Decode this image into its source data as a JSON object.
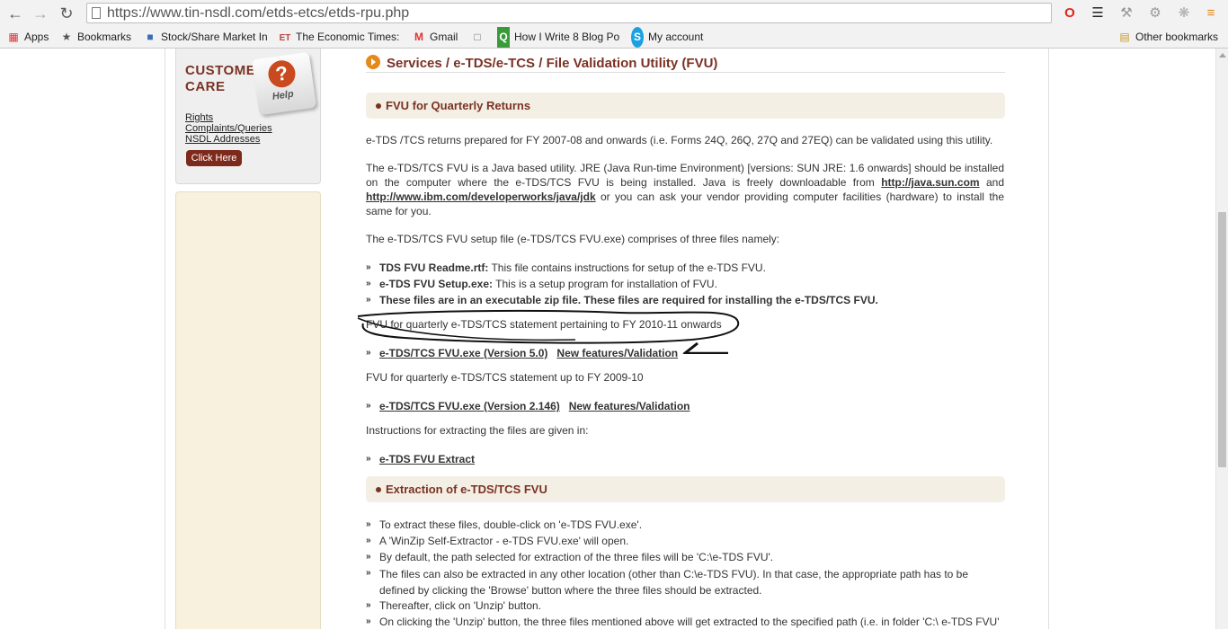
{
  "browser": {
    "url": "https://www.tin-nsdl.com/etds-etcs/etds-rpu.php",
    "bookmarks": [
      {
        "label": "Apps",
        "icon": "apps-grid-icon"
      },
      {
        "label": "Bookmarks",
        "icon": "star-icon"
      },
      {
        "label": "Stock/Share Market In",
        "icon": "site-favicon"
      },
      {
        "label": "The Economic Times:",
        "icon": "et-favicon"
      },
      {
        "label": "Gmail",
        "icon": "gmail-icon"
      },
      {
        "label": "",
        "icon": "page-icon"
      },
      {
        "label": "How I Write 8 Blog Po",
        "icon": "q-favicon"
      },
      {
        "label": "My account",
        "icon": "skype-icon"
      }
    ],
    "other_bookmarks": "Other bookmarks"
  },
  "sidebar": {
    "customer_care_line1": "CUSTOMER",
    "customer_care_line2": "CARE",
    "help_label": "Help",
    "links": [
      "Rights",
      "Complaints/Queries",
      "NSDL Addresses"
    ],
    "click_here": "Click Here"
  },
  "main": {
    "breadcrumb": "Services / e-TDS/e-TCS / File Validation Utility (FVU)",
    "section1": "FVU for Quarterly Returns",
    "para1": "e-TDS /TCS returns prepared for FY 2007-08 and onwards (i.e. Forms 24Q, 26Q, 27Q and 27EQ) can be validated using this utility.",
    "para2_a": "The e-TDS/TCS FVU is a Java based utility. JRE (Java Run-time Environment) [versions: SUN JRE: 1.6 onwards] should be installed on the computer where the e-TDS/TCS FVU is being installed. Java is freely downloadable from ",
    "para2_link1": "http://java.sun.com",
    "para2_b": " and ",
    "para2_link2": "http://www.ibm.com/developerworks/java/jdk",
    "para2_c": " or you can ask your vendor providing computer facilities (hardware) to install the same for you.",
    "para3": "The e-TDS/TCS FVU setup file (e-TDS/TCS FVU.exe) comprises of three files namely:",
    "files": [
      {
        "name": "TDS FVU Readme.rtf:",
        "desc": " This file contains instructions for setup of the e-TDS FVU."
      },
      {
        "name": "e-TDS FVU Setup.exe:",
        "desc": " This is a setup program for installation of FVU."
      },
      {
        "name": "These files are in an executable zip file. These files are required for installing the e-TDS/TCS FVU.",
        "desc": ""
      }
    ],
    "fvu_2010": "FVU for quarterly e-TDS/TCS statement pertaining to FY 2010-11 onwards",
    "link_v50": "e-TDS/TCS FVU.exe (Version 5.0)",
    "link_new1": "New features/Validation",
    "fvu_2009": "FVU for quarterly e-TDS/TCS statement up to FY 2009-10",
    "link_v2146": "e-TDS/TCS FVU.exe (Version 2.146)",
    "link_new2": "New features/Validation",
    "instructions": "Instructions for extracting the files are given in:",
    "link_extract": "e-TDS FVU Extract",
    "section2": "Extraction of e-TDS/TCS FVU",
    "steps": [
      "To extract these files, double-click on 'e-TDS FVU.exe'.",
      "A 'WinZip Self-Extractor - e-TDS FVU.exe' will open.",
      "By default, the path selected for extraction of the three files will be 'C:\\e-TDS FVU'.",
      "The files can also be extracted in any other location (other than C:\\e-TDS FVU). In that case, the appropriate path has to be defined by clicking the 'Browse' button where the three files should be extracted.",
      "Thereafter, click on 'Unzip' button.",
      "On clicking the 'Unzip' button, the three files mentioned above will get extracted to the specified path (i.e. in folder 'C:\\ e-TDS FVU'"
    ]
  }
}
